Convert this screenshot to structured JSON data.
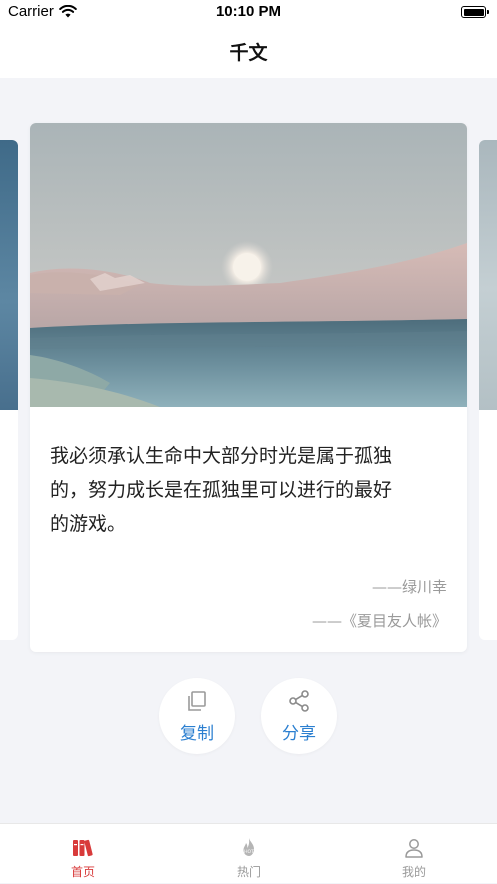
{
  "status_bar": {
    "carrier": "Carrier",
    "time": "10:10 PM"
  },
  "nav": {
    "title": "千文"
  },
  "card": {
    "quote_lines": [
      "我必须承认生命中大部分时光是属于孤独",
      "的，努力成长是在孤独里可以进行的最好",
      "的游戏。"
    ],
    "author": "——绿川幸",
    "source": "——《夏目友人帐》"
  },
  "actions": {
    "copy_label": "复制",
    "share_label": "分享"
  },
  "tabs": [
    {
      "label": "首页",
      "icon": "books-icon",
      "active": true
    },
    {
      "label": "热门",
      "icon": "hot-icon",
      "active": false
    },
    {
      "label": "我的",
      "icon": "user-icon",
      "active": false
    }
  ],
  "colors": {
    "accent": "#2b7fd0",
    "tab_active": "#d83a3a",
    "tab_inactive": "#999999",
    "background": "#f3f4f8"
  }
}
